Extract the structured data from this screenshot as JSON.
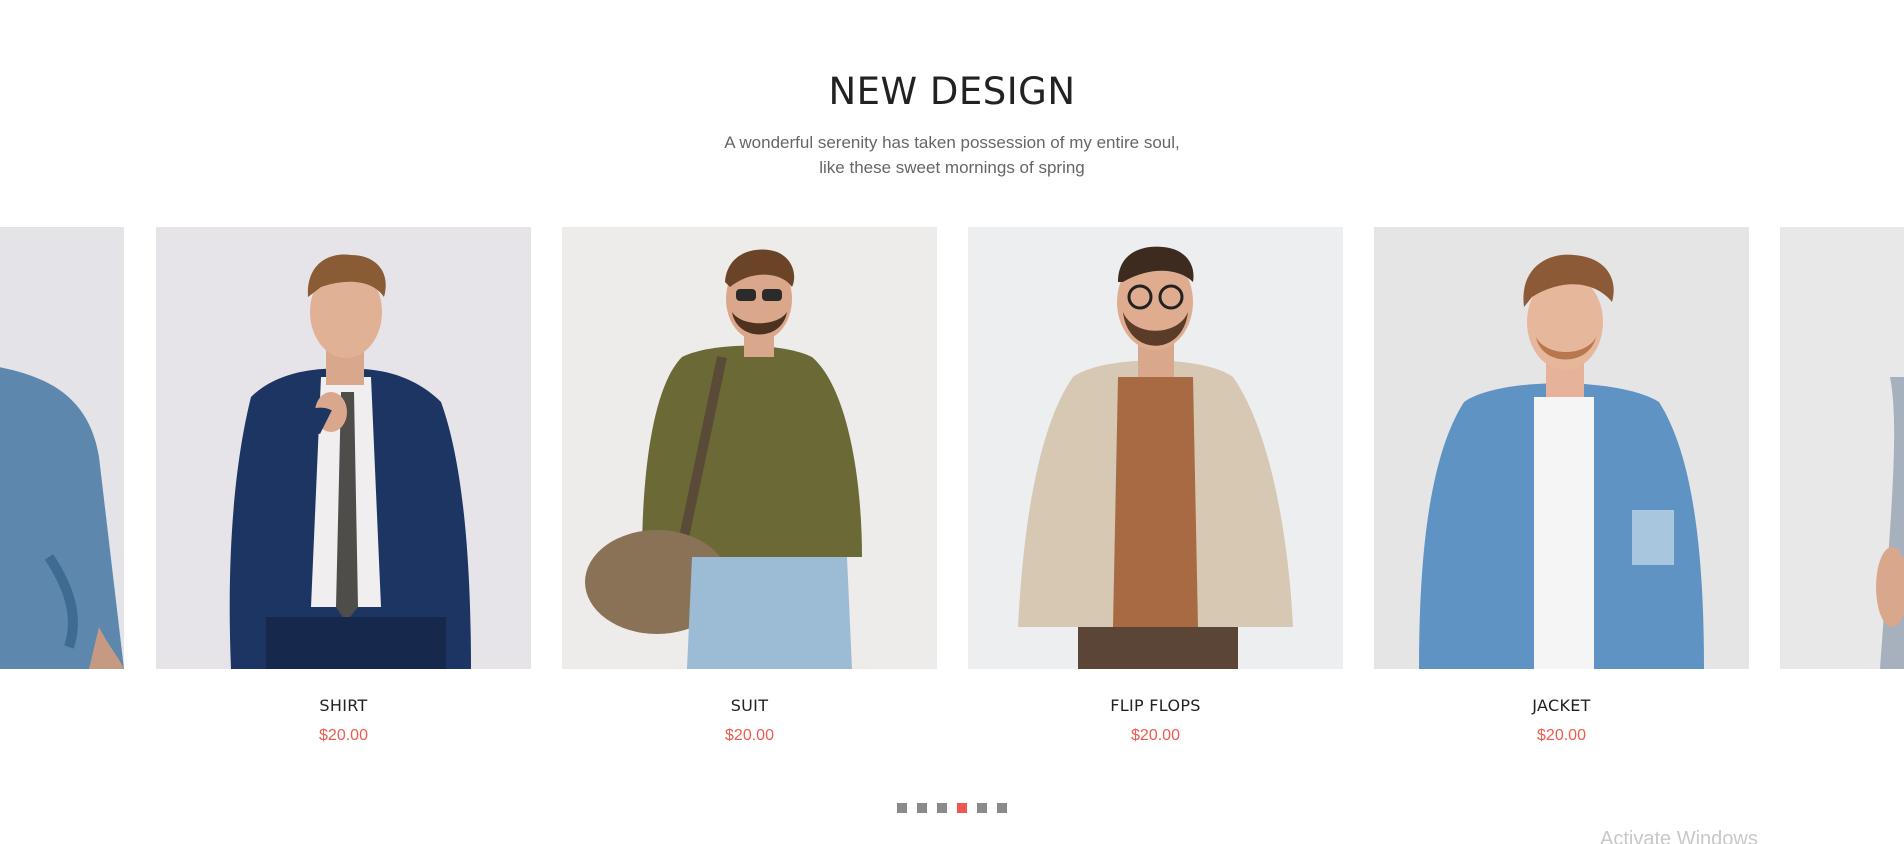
{
  "section": {
    "title": "NEW DESIGN",
    "subtitle_line1": "A wonderful serenity has taken possession of my entire soul,",
    "subtitle_line2": "like these sweet mornings of spring"
  },
  "products": [
    {
      "name": "SHIRT",
      "price": "$20.00"
    },
    {
      "name": "SUIT",
      "price": "$20.00"
    },
    {
      "name": "FLIP FLOPS",
      "price": "$20.00"
    },
    {
      "name": "JACKET",
      "price": "$20.00"
    }
  ],
  "pagination": {
    "count": 6,
    "active_index": 3
  },
  "watermark": "Activate Windows",
  "colors": {
    "accent": "#ee5a4f",
    "title": "#222222",
    "subtitle": "#666666",
    "dot_inactive": "#8a8a8a"
  }
}
